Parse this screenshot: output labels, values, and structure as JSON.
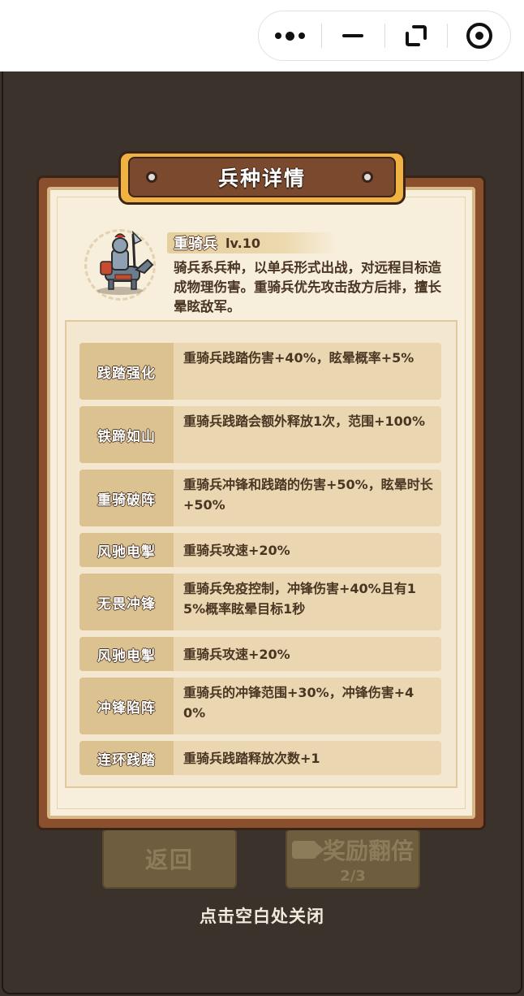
{
  "topbar": {
    "more_icon": "more-dots-icon",
    "minimize_icon": "minus-icon",
    "expand_icon": "expand-icon",
    "close_icon": "target-close-icon"
  },
  "panel": {
    "title": "兵种详情",
    "unit": {
      "name": "重骑兵",
      "level": "lv.10",
      "description": "骑兵系兵种，以单兵形式出战，对远程目标造成物理伤害。重骑兵优先攻击敌方后排，擅长晕眩敌军。"
    },
    "skills": [
      {
        "name": "践踏强化",
        "effect": "重骑兵践踏伤害+40%，眩晕概率+5%"
      },
      {
        "name": "铁蹄如山",
        "effect": "重骑兵践踏会额外释放1次，范围+100%"
      },
      {
        "name": "重骑破阵",
        "effect": "重骑兵冲锋和践踏的伤害+50%，眩晕时长+50%"
      },
      {
        "name": "风驰电掣",
        "effect": "重骑兵攻速+20%"
      },
      {
        "name": "无畏冲锋",
        "effect": "重骑兵免疫控制，冲锋伤害+40%且有15%概率眩晕目标1秒"
      },
      {
        "name": "风驰电掣",
        "effect": "重骑兵攻速+20%"
      },
      {
        "name": "冲锋陷阵",
        "effect": "重骑兵的冲锋范围+30%，冲锋伤害+40%"
      },
      {
        "name": "连环践踏",
        "effect": "重骑兵践踏释放次数+1"
      }
    ]
  },
  "background_buttons": {
    "back_label": "返回",
    "double_label": "奖励翻倍",
    "double_count": "2/3"
  },
  "close_hint": "点击空白处关闭",
  "colors": {
    "panel_bg": "#f7eedb",
    "frame": "#8a4f2c",
    "banner_gold": "#f0b341",
    "text_brown": "#4a3523"
  }
}
